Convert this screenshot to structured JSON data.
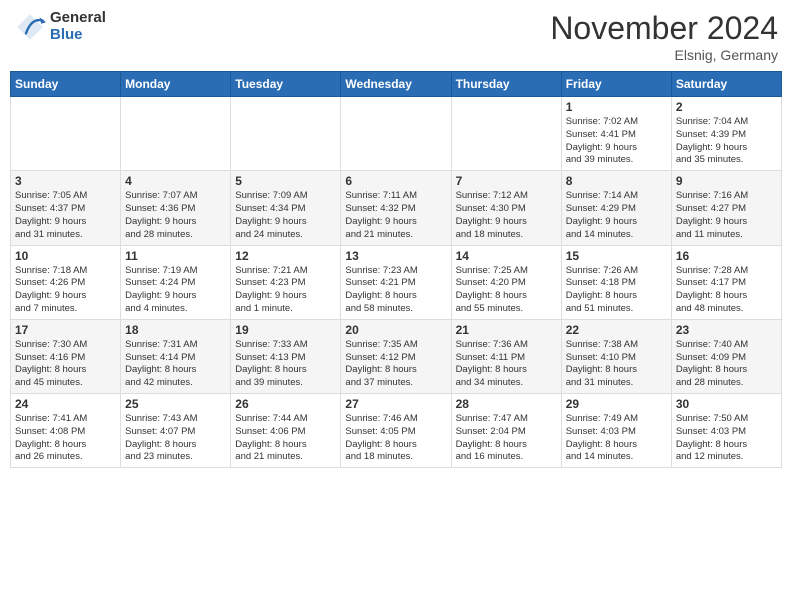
{
  "logo": {
    "general": "General",
    "blue": "Blue"
  },
  "title": "November 2024",
  "location": "Elsnig, Germany",
  "headers": [
    "Sunday",
    "Monday",
    "Tuesday",
    "Wednesday",
    "Thursday",
    "Friday",
    "Saturday"
  ],
  "weeks": [
    [
      {
        "day": "",
        "info": ""
      },
      {
        "day": "",
        "info": ""
      },
      {
        "day": "",
        "info": ""
      },
      {
        "day": "",
        "info": ""
      },
      {
        "day": "",
        "info": ""
      },
      {
        "day": "1",
        "info": "Sunrise: 7:02 AM\nSunset: 4:41 PM\nDaylight: 9 hours\nand 39 minutes."
      },
      {
        "day": "2",
        "info": "Sunrise: 7:04 AM\nSunset: 4:39 PM\nDaylight: 9 hours\nand 35 minutes."
      }
    ],
    [
      {
        "day": "3",
        "info": "Sunrise: 7:05 AM\nSunset: 4:37 PM\nDaylight: 9 hours\nand 31 minutes."
      },
      {
        "day": "4",
        "info": "Sunrise: 7:07 AM\nSunset: 4:36 PM\nDaylight: 9 hours\nand 28 minutes."
      },
      {
        "day": "5",
        "info": "Sunrise: 7:09 AM\nSunset: 4:34 PM\nDaylight: 9 hours\nand 24 minutes."
      },
      {
        "day": "6",
        "info": "Sunrise: 7:11 AM\nSunset: 4:32 PM\nDaylight: 9 hours\nand 21 minutes."
      },
      {
        "day": "7",
        "info": "Sunrise: 7:12 AM\nSunset: 4:30 PM\nDaylight: 9 hours\nand 18 minutes."
      },
      {
        "day": "8",
        "info": "Sunrise: 7:14 AM\nSunset: 4:29 PM\nDaylight: 9 hours\nand 14 minutes."
      },
      {
        "day": "9",
        "info": "Sunrise: 7:16 AM\nSunset: 4:27 PM\nDaylight: 9 hours\nand 11 minutes."
      }
    ],
    [
      {
        "day": "10",
        "info": "Sunrise: 7:18 AM\nSunset: 4:26 PM\nDaylight: 9 hours\nand 7 minutes."
      },
      {
        "day": "11",
        "info": "Sunrise: 7:19 AM\nSunset: 4:24 PM\nDaylight: 9 hours\nand 4 minutes."
      },
      {
        "day": "12",
        "info": "Sunrise: 7:21 AM\nSunset: 4:23 PM\nDaylight: 9 hours\nand 1 minute."
      },
      {
        "day": "13",
        "info": "Sunrise: 7:23 AM\nSunset: 4:21 PM\nDaylight: 8 hours\nand 58 minutes."
      },
      {
        "day": "14",
        "info": "Sunrise: 7:25 AM\nSunset: 4:20 PM\nDaylight: 8 hours\nand 55 minutes."
      },
      {
        "day": "15",
        "info": "Sunrise: 7:26 AM\nSunset: 4:18 PM\nDaylight: 8 hours\nand 51 minutes."
      },
      {
        "day": "16",
        "info": "Sunrise: 7:28 AM\nSunset: 4:17 PM\nDaylight: 8 hours\nand 48 minutes."
      }
    ],
    [
      {
        "day": "17",
        "info": "Sunrise: 7:30 AM\nSunset: 4:16 PM\nDaylight: 8 hours\nand 45 minutes."
      },
      {
        "day": "18",
        "info": "Sunrise: 7:31 AM\nSunset: 4:14 PM\nDaylight: 8 hours\nand 42 minutes."
      },
      {
        "day": "19",
        "info": "Sunrise: 7:33 AM\nSunset: 4:13 PM\nDaylight: 8 hours\nand 39 minutes."
      },
      {
        "day": "20",
        "info": "Sunrise: 7:35 AM\nSunset: 4:12 PM\nDaylight: 8 hours\nand 37 minutes."
      },
      {
        "day": "21",
        "info": "Sunrise: 7:36 AM\nSunset: 4:11 PM\nDaylight: 8 hours\nand 34 minutes."
      },
      {
        "day": "22",
        "info": "Sunrise: 7:38 AM\nSunset: 4:10 PM\nDaylight: 8 hours\nand 31 minutes."
      },
      {
        "day": "23",
        "info": "Sunrise: 7:40 AM\nSunset: 4:09 PM\nDaylight: 8 hours\nand 28 minutes."
      }
    ],
    [
      {
        "day": "24",
        "info": "Sunrise: 7:41 AM\nSunset: 4:08 PM\nDaylight: 8 hours\nand 26 minutes."
      },
      {
        "day": "25",
        "info": "Sunrise: 7:43 AM\nSunset: 4:07 PM\nDaylight: 8 hours\nand 23 minutes."
      },
      {
        "day": "26",
        "info": "Sunrise: 7:44 AM\nSunset: 4:06 PM\nDaylight: 8 hours\nand 21 minutes."
      },
      {
        "day": "27",
        "info": "Sunrise: 7:46 AM\nSunset: 4:05 PM\nDaylight: 8 hours\nand 18 minutes."
      },
      {
        "day": "28",
        "info": "Sunrise: 7:47 AM\nSunset: 2:04 PM\nDaylight: 8 hours\nand 16 minutes."
      },
      {
        "day": "29",
        "info": "Sunrise: 7:49 AM\nSunset: 4:03 PM\nDaylight: 8 hours\nand 14 minutes."
      },
      {
        "day": "30",
        "info": "Sunrise: 7:50 AM\nSunset: 4:03 PM\nDaylight: 8 hours\nand 12 minutes."
      }
    ]
  ]
}
